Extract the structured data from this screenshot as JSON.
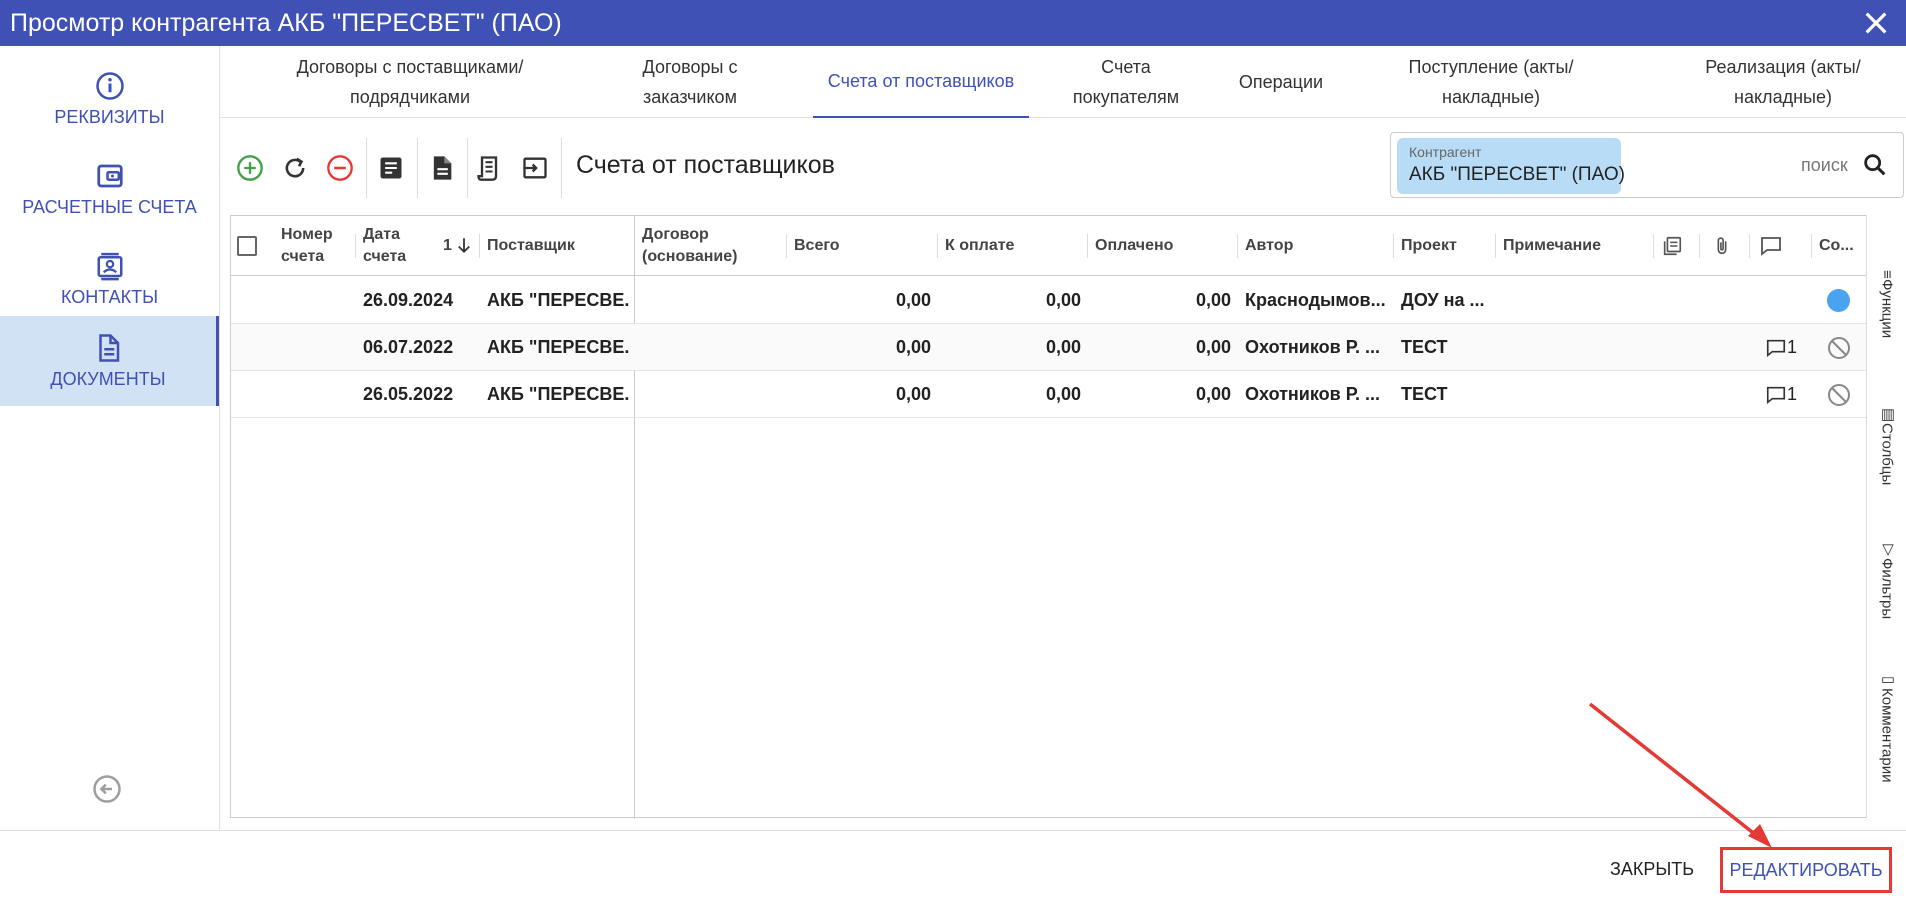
{
  "window": {
    "title": "Просмотр контрагента АКБ \"ПЕРЕСВЕТ\" (ПАО)"
  },
  "sidebar": {
    "items": [
      {
        "label": "РЕКВИЗИТЫ",
        "icon": "info-icon"
      },
      {
        "label": "РАСЧЕТНЫЕ СЧЕТА",
        "icon": "wallet-icon"
      },
      {
        "label": "КОНТАКТЫ",
        "icon": "contact-card-icon"
      },
      {
        "label": "ДОКУМЕНТЫ",
        "icon": "document-icon"
      }
    ]
  },
  "tabs": [
    {
      "label": "Договоры с поставщиками/ подрядчиками"
    },
    {
      "label": "Договоры с заказчиком"
    },
    {
      "label": "Счета от поставщиков",
      "active": true
    },
    {
      "label": "Счета покупателям"
    },
    {
      "label": "Операции"
    },
    {
      "label": "Поступление (акты/ накладные)"
    },
    {
      "label": "Реализация (акты/ накладные)"
    }
  ],
  "toolbar": {
    "title": "Счета от поставщиков",
    "buttons": [
      "add-icon",
      "refresh-icon",
      "remove-icon",
      "doc-list-icon",
      "doc-icon",
      "receipt-icon",
      "export-icon"
    ]
  },
  "search": {
    "chip_label": "Контрагент",
    "chip_value": "АКБ \"ПЕРЕСВЕТ\" (ПАО)",
    "placeholder": "поиск"
  },
  "table": {
    "columns": {
      "number": "Номер счета",
      "date": "Дата счета",
      "sort": "1",
      "supplier": "Поставщик",
      "contract": "Договор (основание)",
      "total": "Всего",
      "to_pay": "К оплате",
      "paid": "Оплачено",
      "author": "Автор",
      "project": "Проект",
      "note": "Примечание",
      "status": "Со..."
    },
    "rows": [
      {
        "number": "",
        "date": "26.09.2024",
        "supplier": "АКБ \"ПЕРЕСВЕ...",
        "contract": "",
        "total": "0,00",
        "to_pay": "0,00",
        "paid": "0,00",
        "author": "Краснодымов...",
        "project": "ДОУ на ...",
        "note": "",
        "comments": "",
        "status": "active"
      },
      {
        "number": "",
        "date": "06.07.2022",
        "supplier": "АКБ \"ПЕРЕСВЕ...",
        "contract": "",
        "total": "0,00",
        "to_pay": "0,00",
        "paid": "0,00",
        "author": "Охотников Р. ...",
        "project": "ТЕСТ",
        "note": "",
        "comments": "1",
        "status": "blocked"
      },
      {
        "number": "",
        "date": "26.05.2022",
        "supplier": "АКБ \"ПЕРЕСВЕ...",
        "contract": "",
        "total": "0,00",
        "to_pay": "0,00",
        "paid": "0,00",
        "author": "Охотников Р. ...",
        "project": "ТЕСТ",
        "note": "",
        "comments": "1",
        "status": "blocked"
      }
    ]
  },
  "right_panel": [
    "Функции",
    "Столбцы",
    "Фильтры",
    "Комментарии"
  ],
  "footer": {
    "close_label": "ЗАКРЫТЬ",
    "edit_label": "РЕДАКТИРОВАТЬ"
  },
  "colors": {
    "primary": "#3f51b5",
    "active_bg": "#d2e2f5",
    "chip_bg": "#b8dcf5",
    "highlight": "#e53935",
    "status_active": "#4aa3f0"
  }
}
